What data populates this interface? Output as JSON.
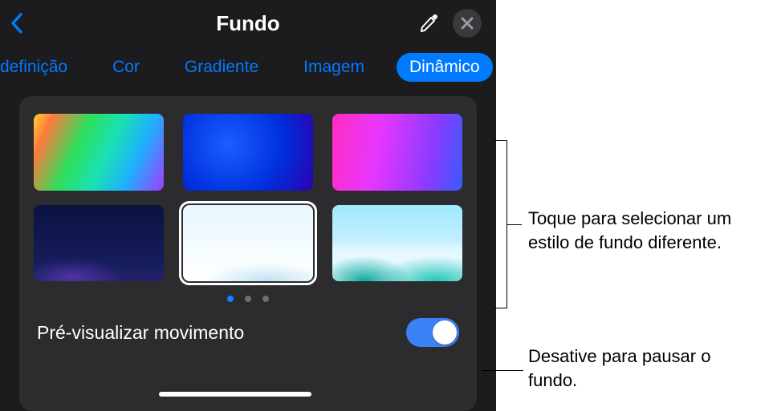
{
  "header": {
    "title": "Fundo"
  },
  "tabs": {
    "items": [
      {
        "label": "definição",
        "active": false
      },
      {
        "label": "Cor",
        "active": false
      },
      {
        "label": "Gradiente",
        "active": false
      },
      {
        "label": "Imagem",
        "active": false
      },
      {
        "label": "Dinâmico",
        "active": true
      }
    ]
  },
  "pager": {
    "count": 3,
    "active_index": 0
  },
  "toggle": {
    "label": "Pré-visualizar movimento",
    "value": true
  },
  "callouts": {
    "select_style": "Toque para selecionar um estilo de fundo diferente.",
    "pause_toggle": "Desative para pausar o fundo."
  },
  "icons": {
    "back": "chevron-left",
    "eyedropper": "eyedropper",
    "close": "xmark"
  }
}
